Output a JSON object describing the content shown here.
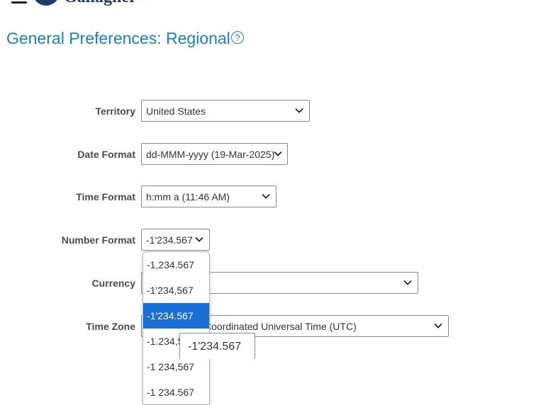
{
  "header": {
    "logo_text": "Gallagher"
  },
  "page": {
    "title": "General Preferences: Regional",
    "help_glyph": "?"
  },
  "form": {
    "territory": {
      "label": "Territory",
      "value": "United States"
    },
    "date_format": {
      "label": "Date Format",
      "value": "dd-MMM-yyyy (19-Mar-2025)"
    },
    "time_format": {
      "label": "Time Format",
      "value": "h:mm a (11:46 AM)"
    },
    "number_format": {
      "label": "Number Format",
      "value": "-1'234.567",
      "options": [
        "-1,234.567",
        "-1'234,567",
        "-1'234.567",
        "-1.234,5",
        "-1 234,567",
        "-1 234.567"
      ],
      "selected_index": 2,
      "tooltip": "-1'234.567"
    },
    "currency": {
      "label": "Currency",
      "value": ""
    },
    "time_zone": {
      "label": "Time Zone",
      "value": "Coordinated Universal Time (UTC)"
    }
  },
  "colors": {
    "accent": "#1a7fc1",
    "selected_option": "#1a6fd6"
  }
}
